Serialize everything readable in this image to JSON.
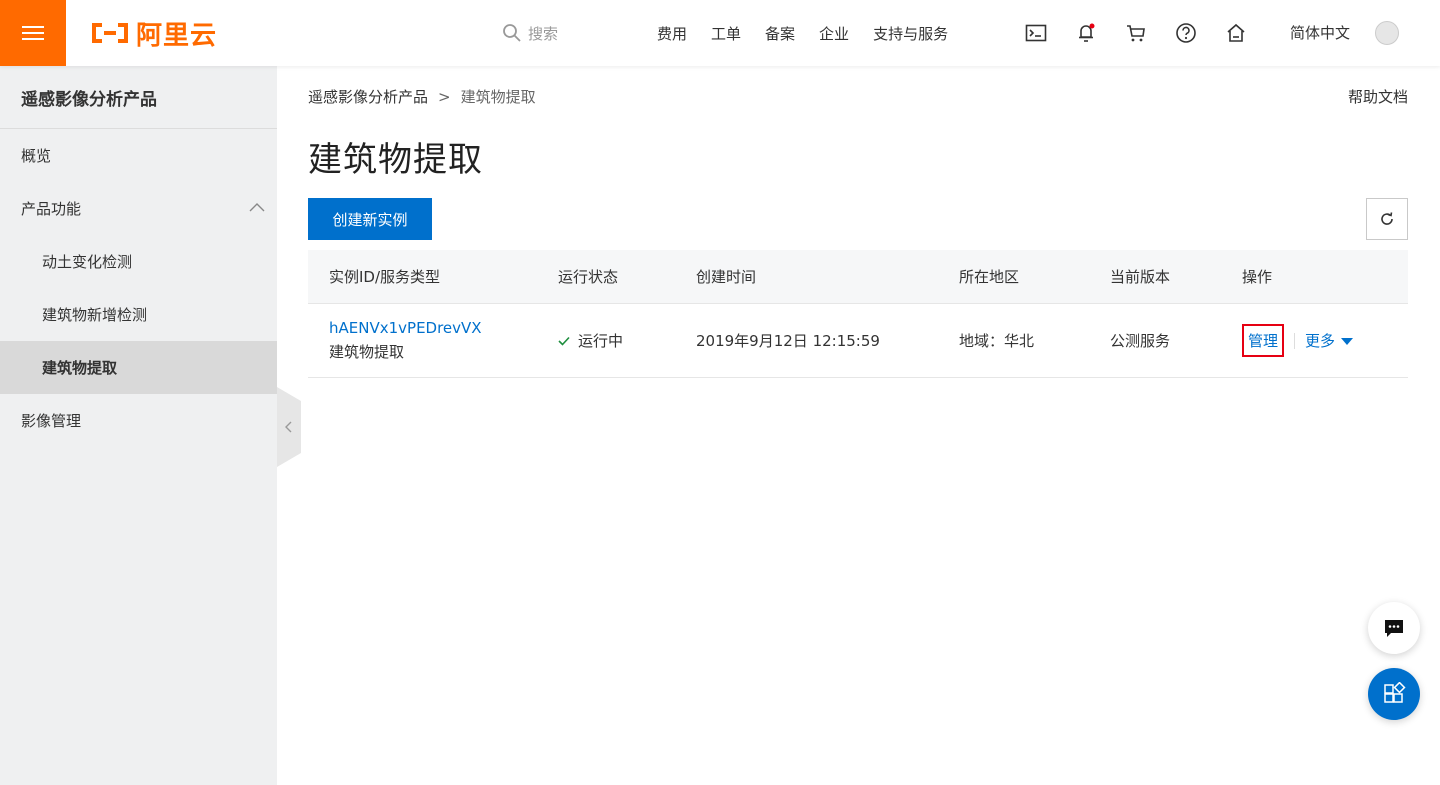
{
  "header": {
    "logo_text": "阿里云",
    "search_placeholder": "搜索",
    "nav": [
      "费用",
      "工单",
      "备案",
      "企业",
      "支持与服务"
    ],
    "language": "简体中文",
    "icons": [
      "terminal-icon",
      "bell-icon",
      "cart-icon",
      "help-icon",
      "home-icon"
    ],
    "brand_color": "#ff6a00"
  },
  "sidebar": {
    "title": "遥感影像分析产品",
    "items": [
      {
        "label": "概览"
      },
      {
        "label": "产品功能"
      },
      {
        "label": "动土变化检测"
      },
      {
        "label": "建筑物新增检测"
      },
      {
        "label": "建筑物提取"
      },
      {
        "label": "影像管理"
      }
    ]
  },
  "main": {
    "breadcrumb": [
      "遥感影像分析产品",
      "建筑物提取"
    ],
    "help_link": "帮助文档",
    "title": "建筑物提取",
    "create_button": "创建新实例",
    "table": {
      "columns": [
        "实例ID/服务类型",
        "运行状态",
        "创建时间",
        "所在地区",
        "当前版本",
        "操作"
      ],
      "rows": [
        {
          "instance_id": "hAENVx1vPEDrevVX",
          "service_type": "建筑物提取",
          "status": "运行中",
          "created": "2019年9月12日 12:15:59",
          "region": "地域：华北",
          "version": "公测服务",
          "manage": "管理",
          "more": "更多"
        }
      ]
    },
    "accent_color": "#0070cc",
    "highlight_color": "#e60012"
  }
}
